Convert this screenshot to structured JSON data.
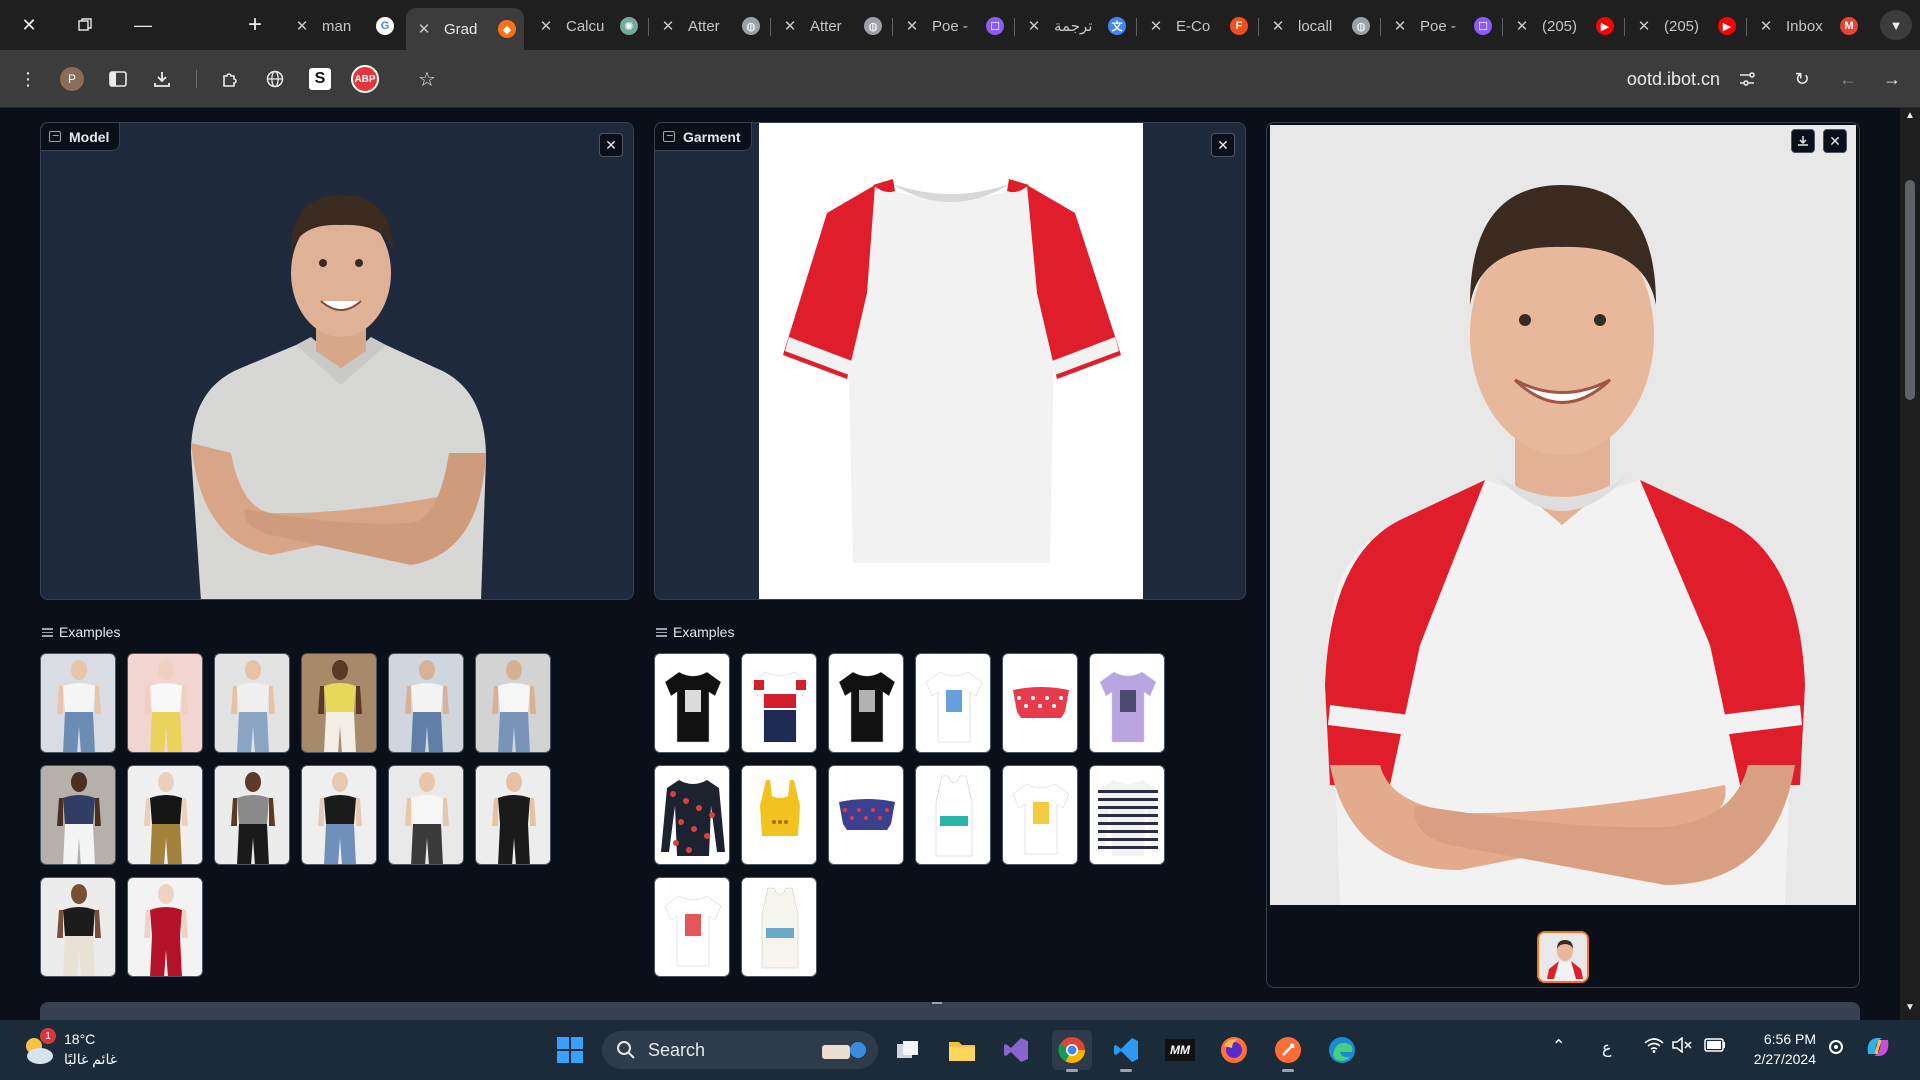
{
  "browser": {
    "tabs": [
      {
        "title": "man",
        "favicon": "google-icon",
        "active": false
      },
      {
        "title": "Grad",
        "favicon": "gradio-icon",
        "active": true
      },
      {
        "title": "Calcu",
        "favicon": "chatgpt-icon",
        "active": false
      },
      {
        "title": "Atter",
        "favicon": "globe-icon",
        "active": false
      },
      {
        "title": "Atter",
        "favicon": "globe-icon",
        "active": false
      },
      {
        "title": "Poe -",
        "favicon": "poe-icon",
        "active": false
      },
      {
        "title": "ترجمة",
        "favicon": "translate-icon",
        "active": false
      },
      {
        "title": "E-Co",
        "favicon": "figma-icon",
        "active": false
      },
      {
        "title": "locall",
        "favicon": "globe-icon",
        "active": false
      },
      {
        "title": "Poe -",
        "favicon": "poe-icon",
        "active": false
      },
      {
        "title": "(205)",
        "favicon": "youtube-icon",
        "active": false
      },
      {
        "title": "(205)",
        "favicon": "youtube-icon",
        "active": false
      },
      {
        "title": "Inbox",
        "favicon": "gmail-icon",
        "active": false
      }
    ],
    "profile_initial": "P",
    "abp_label": "ABP",
    "s_ext_label": "S",
    "url": "ootd.ibot.cn"
  },
  "model_panel": {
    "label": "Model"
  },
  "garment_panel": {
    "label": "Garment"
  },
  "model_examples": {
    "label": "Examples",
    "items": [
      {
        "top": "#f5f5f5",
        "bottom": "#6b8cb5",
        "skin": "#e8c4a8",
        "bg": "#d9dde3"
      },
      {
        "top": "#f8f8f8",
        "bottom": "#e9d35a",
        "skin": "#f1cfc0",
        "bg": "#f2d4d0"
      },
      {
        "top": "#f0f0f0",
        "bottom": "#8aa4c4",
        "skin": "#e6c3a7",
        "bg": "#e3e3e3"
      },
      {
        "top": "#e7d85a",
        "bottom": "#f2eee6",
        "skin": "#5a3a26",
        "bg": "#a68a6a"
      },
      {
        "top": "#f3f3f3",
        "bottom": "#5f7fa8",
        "skin": "#d9b196",
        "bg": "#cfd6de"
      },
      {
        "top": "#f6f6f6",
        "bottom": "#7894b8",
        "skin": "#d8b193",
        "bg": "#d3d3d3"
      },
      {
        "top": "#2f3e62",
        "bottom": "#f4f4f4",
        "skin": "#4a2f22",
        "bg": "#b5b0aa"
      },
      {
        "top": "#161616",
        "bottom": "#a5823c",
        "skin": "#ecd0bb",
        "bg": "#f0f0f0"
      },
      {
        "top": "#8a8a8a",
        "bottom": "#1a1a1a",
        "skin": "#5b3a28",
        "bg": "#ececec"
      },
      {
        "top": "#1b1b1b",
        "bottom": "#6f90bb",
        "skin": "#e8c9b4",
        "bg": "#efefef"
      },
      {
        "top": "#f6f6f6",
        "bottom": "#3a3a3a",
        "skin": "#e8c6a8",
        "bg": "#e9e9e9"
      },
      {
        "top": "#1a1a1a",
        "bottom": "#1a1a1a",
        "skin": "#e6c2a4",
        "bg": "#ededed"
      },
      {
        "top": "#1c1c1c",
        "bottom": "#e9e1d3",
        "skin": "#7a4e35",
        "bg": "#ececec"
      },
      {
        "top": "#b3122a",
        "bottom": "#b3122a",
        "skin": "#efd3c2",
        "bg": "#f3f3f3"
      }
    ]
  },
  "garment_examples": {
    "label": "Examples",
    "items": [
      {
        "main": "#111111",
        "accent": "#ffffff",
        "shape": "tee"
      },
      {
        "main": "#ffffff",
        "accent": "#d21f2c",
        "shape": "tee-fila"
      },
      {
        "main": "#111111",
        "accent": "#cfcfcf",
        "shape": "tee"
      },
      {
        "main": "#ffffff",
        "accent": "#4b8fd6",
        "shape": "tee"
      },
      {
        "main": "#e63b4a",
        "accent": "#ffffff",
        "shape": "offshoulder"
      },
      {
        "main": "#b9a6e0",
        "accent": "#3a3a5a",
        "shape": "tee"
      },
      {
        "main": "#1d2230",
        "accent": "#d9423a",
        "shape": "longsleeve"
      },
      {
        "main": "#f2c21e",
        "accent": "#a66b00",
        "shape": "crop"
      },
      {
        "main": "#3a3f8f",
        "accent": "#e33b3b",
        "shape": "offshoulder"
      },
      {
        "main": "#ffffff",
        "accent": "#27b7a8",
        "shape": "tank"
      },
      {
        "main": "#ffffff",
        "accent": "#f2c21e",
        "shape": "tee"
      },
      {
        "main": "#f3f3f3",
        "accent": "#2a2e44",
        "shape": "longsleeve-stripe"
      },
      {
        "main": "#ffffff",
        "accent": "#e03a3a",
        "shape": "tee"
      },
      {
        "main": "#f7f5ee",
        "accent": "#6aa9c9",
        "shape": "tank"
      }
    ]
  },
  "colors": {
    "tee_white": "#f2f2f2",
    "tee_red": "#e01e2b",
    "polo_gray": "#d7d7d6",
    "panel_bg": "#1e293b",
    "result_bg": "#e8e8e8"
  },
  "taskbar": {
    "weather_temp": "18°C",
    "weather_desc": "غائم غالبًا",
    "weather_badge": "1",
    "search_label": "Search",
    "lang": "ع",
    "time": "6:56 PM",
    "date": "2/27/2024"
  }
}
